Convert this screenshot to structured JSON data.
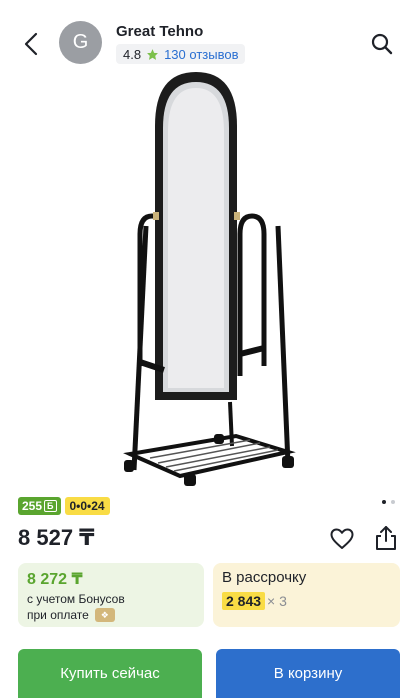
{
  "header": {
    "avatar_letter": "G",
    "shop_name": "Great Tehno",
    "rating": "4.8",
    "reviews": "130 отзывов"
  },
  "gallery": {
    "image_icon": "floor-mirror-product-image",
    "page_count": 2,
    "active_page": 1
  },
  "badges": {
    "bonus": "255",
    "bonus_sign": "Б",
    "installment": "0•0•24"
  },
  "price": "8 527 ₸",
  "bonus_offer": {
    "price": "8 272 ₸",
    "line1": "с учетом Бонусов",
    "line2": "при оплате"
  },
  "installment_offer": {
    "label": "В рассрочку",
    "amount": "2 843",
    "multiplier": "× 3"
  },
  "actions": {
    "buy_now": "Купить сейчас",
    "add_to_cart": "В корзину"
  },
  "colors": {
    "green": "#4caf50",
    "blue": "#2d6fcc",
    "yellow": "#f9dc45",
    "bonus_green": "#5aa52f"
  }
}
